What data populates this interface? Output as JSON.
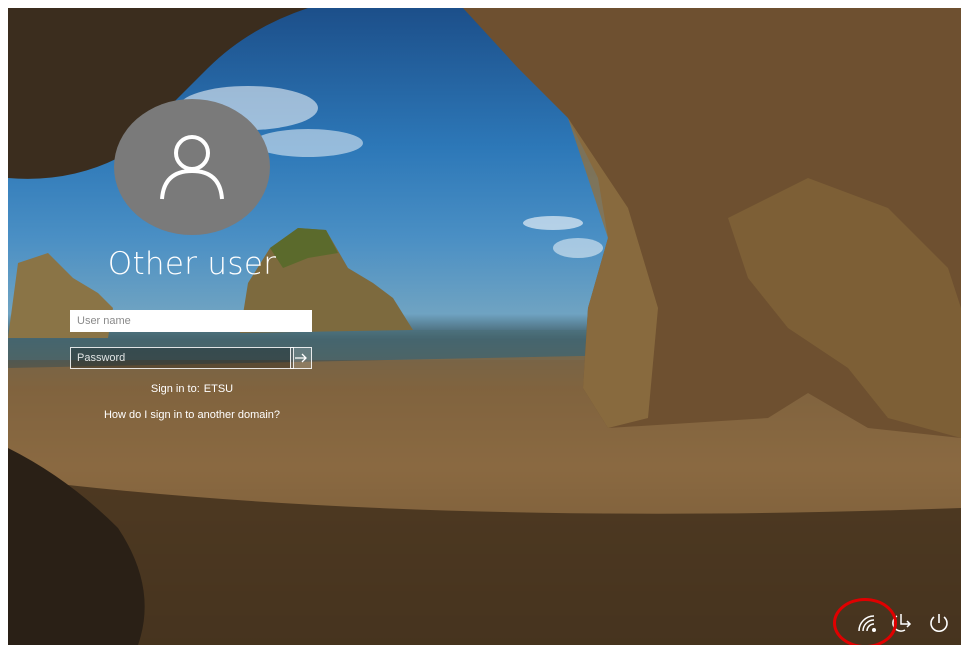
{
  "user": {
    "display_name": "Other user",
    "username_placeholder": "User name",
    "password_placeholder": "Password",
    "submit_icon": "arrow-right-icon"
  },
  "signin": {
    "label": "Sign in to:",
    "domain": "ETSU",
    "help_link": "How do I sign in to another domain?"
  },
  "tray": {
    "network_icon": "wifi-icon",
    "accessibility_icon": "ease-of-access-icon",
    "power_icon": "power-icon"
  },
  "colors": {
    "highlight": "#e00000",
    "avatar_bg": "#7a7a7a"
  }
}
